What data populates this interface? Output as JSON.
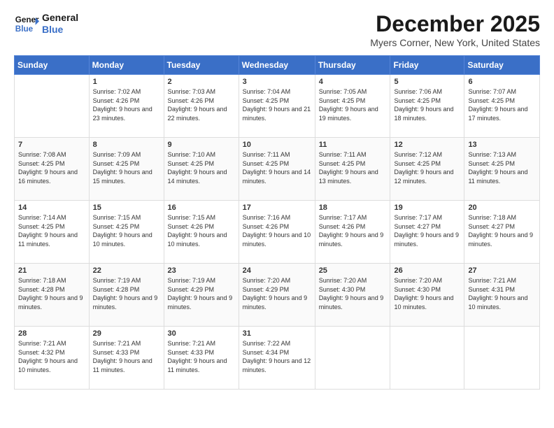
{
  "logo": {
    "line1": "General",
    "line2": "Blue"
  },
  "title": "December 2025",
  "subtitle": "Myers Corner, New York, United States",
  "header": {
    "days": [
      "Sunday",
      "Monday",
      "Tuesday",
      "Wednesday",
      "Thursday",
      "Friday",
      "Saturday"
    ]
  },
  "weeks": [
    [
      {
        "date": "",
        "empty": true
      },
      {
        "date": "1",
        "sunrise": "7:02 AM",
        "sunset": "4:26 PM",
        "daylight": "9 hours and 23 minutes."
      },
      {
        "date": "2",
        "sunrise": "7:03 AM",
        "sunset": "4:26 PM",
        "daylight": "9 hours and 22 minutes."
      },
      {
        "date": "3",
        "sunrise": "7:04 AM",
        "sunset": "4:25 PM",
        "daylight": "9 hours and 21 minutes."
      },
      {
        "date": "4",
        "sunrise": "7:05 AM",
        "sunset": "4:25 PM",
        "daylight": "9 hours and 19 minutes."
      },
      {
        "date": "5",
        "sunrise": "7:06 AM",
        "sunset": "4:25 PM",
        "daylight": "9 hours and 18 minutes."
      },
      {
        "date": "6",
        "sunrise": "7:07 AM",
        "sunset": "4:25 PM",
        "daylight": "9 hours and 17 minutes."
      }
    ],
    [
      {
        "date": "7",
        "sunrise": "7:08 AM",
        "sunset": "4:25 PM",
        "daylight": "9 hours and 16 minutes."
      },
      {
        "date": "8",
        "sunrise": "7:09 AM",
        "sunset": "4:25 PM",
        "daylight": "9 hours and 15 minutes."
      },
      {
        "date": "9",
        "sunrise": "7:10 AM",
        "sunset": "4:25 PM",
        "daylight": "9 hours and 14 minutes."
      },
      {
        "date": "10",
        "sunrise": "7:11 AM",
        "sunset": "4:25 PM",
        "daylight": "9 hours and 14 minutes."
      },
      {
        "date": "11",
        "sunrise": "7:11 AM",
        "sunset": "4:25 PM",
        "daylight": "9 hours and 13 minutes."
      },
      {
        "date": "12",
        "sunrise": "7:12 AM",
        "sunset": "4:25 PM",
        "daylight": "9 hours and 12 minutes."
      },
      {
        "date": "13",
        "sunrise": "7:13 AM",
        "sunset": "4:25 PM",
        "daylight": "9 hours and 11 minutes."
      }
    ],
    [
      {
        "date": "14",
        "sunrise": "7:14 AM",
        "sunset": "4:25 PM",
        "daylight": "9 hours and 11 minutes."
      },
      {
        "date": "15",
        "sunrise": "7:15 AM",
        "sunset": "4:25 PM",
        "daylight": "9 hours and 10 minutes."
      },
      {
        "date": "16",
        "sunrise": "7:15 AM",
        "sunset": "4:26 PM",
        "daylight": "9 hours and 10 minutes."
      },
      {
        "date": "17",
        "sunrise": "7:16 AM",
        "sunset": "4:26 PM",
        "daylight": "9 hours and 10 minutes."
      },
      {
        "date": "18",
        "sunrise": "7:17 AM",
        "sunset": "4:26 PM",
        "daylight": "9 hours and 9 minutes."
      },
      {
        "date": "19",
        "sunrise": "7:17 AM",
        "sunset": "4:27 PM",
        "daylight": "9 hours and 9 minutes."
      },
      {
        "date": "20",
        "sunrise": "7:18 AM",
        "sunset": "4:27 PM",
        "daylight": "9 hours and 9 minutes."
      }
    ],
    [
      {
        "date": "21",
        "sunrise": "7:18 AM",
        "sunset": "4:28 PM",
        "daylight": "9 hours and 9 minutes."
      },
      {
        "date": "22",
        "sunrise": "7:19 AM",
        "sunset": "4:28 PM",
        "daylight": "9 hours and 9 minutes."
      },
      {
        "date": "23",
        "sunrise": "7:19 AM",
        "sunset": "4:29 PM",
        "daylight": "9 hours and 9 minutes."
      },
      {
        "date": "24",
        "sunrise": "7:20 AM",
        "sunset": "4:29 PM",
        "daylight": "9 hours and 9 minutes."
      },
      {
        "date": "25",
        "sunrise": "7:20 AM",
        "sunset": "4:30 PM",
        "daylight": "9 hours and 9 minutes."
      },
      {
        "date": "26",
        "sunrise": "7:20 AM",
        "sunset": "4:30 PM",
        "daylight": "9 hours and 10 minutes."
      },
      {
        "date": "27",
        "sunrise": "7:21 AM",
        "sunset": "4:31 PM",
        "daylight": "9 hours and 10 minutes."
      }
    ],
    [
      {
        "date": "28",
        "sunrise": "7:21 AM",
        "sunset": "4:32 PM",
        "daylight": "9 hours and 10 minutes."
      },
      {
        "date": "29",
        "sunrise": "7:21 AM",
        "sunset": "4:33 PM",
        "daylight": "9 hours and 11 minutes."
      },
      {
        "date": "30",
        "sunrise": "7:21 AM",
        "sunset": "4:33 PM",
        "daylight": "9 hours and 11 minutes."
      },
      {
        "date": "31",
        "sunrise": "7:22 AM",
        "sunset": "4:34 PM",
        "daylight": "9 hours and 12 minutes."
      },
      {
        "date": "",
        "empty": true
      },
      {
        "date": "",
        "empty": true
      },
      {
        "date": "",
        "empty": true
      }
    ]
  ]
}
